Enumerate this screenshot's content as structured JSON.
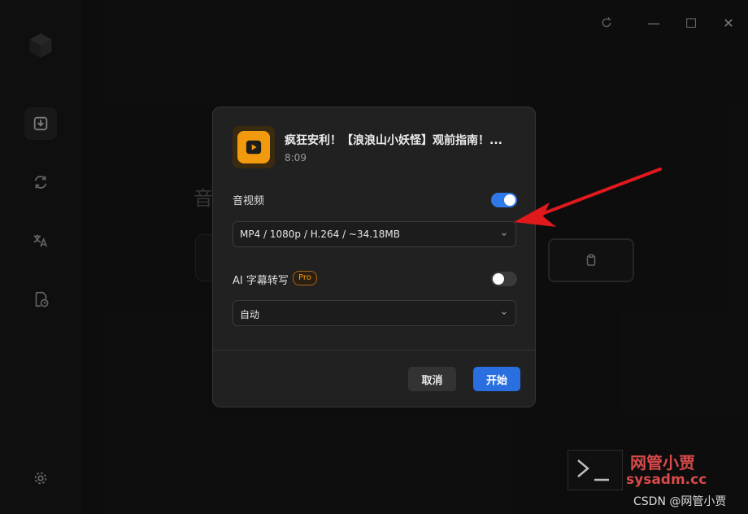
{
  "window": {
    "controls": {
      "minimize": "—",
      "maximize": "☐",
      "close": "✕"
    }
  },
  "sidebar": {
    "items": [
      {
        "name": "download",
        "active": true
      },
      {
        "name": "convert",
        "active": false
      },
      {
        "name": "translate",
        "active": false
      },
      {
        "name": "doc-clock",
        "active": false
      }
    ]
  },
  "background": {
    "heading": "音"
  },
  "dialog": {
    "title": "疯狂安利！【浪浪山小妖怪】观前指南！...",
    "duration": "8:09",
    "audio_video": {
      "label": "音视频",
      "enabled": true,
      "selected": "MP4 / 1080p / H.264 / ~34.18MB"
    },
    "ai_subtitle": {
      "label": "AI 字幕转写",
      "badge": "Pro",
      "enabled": false,
      "selected": "自动"
    },
    "buttons": {
      "cancel": "取消",
      "start": "开始"
    }
  },
  "watermark": {
    "brand": "网管小贾",
    "site": "sysadm.cc",
    "csdn": "CSDN @网管小贾"
  },
  "colors": {
    "accent": "#2f78e8",
    "brand_orange": "#f29a0d",
    "arrow": "#e0191c"
  }
}
